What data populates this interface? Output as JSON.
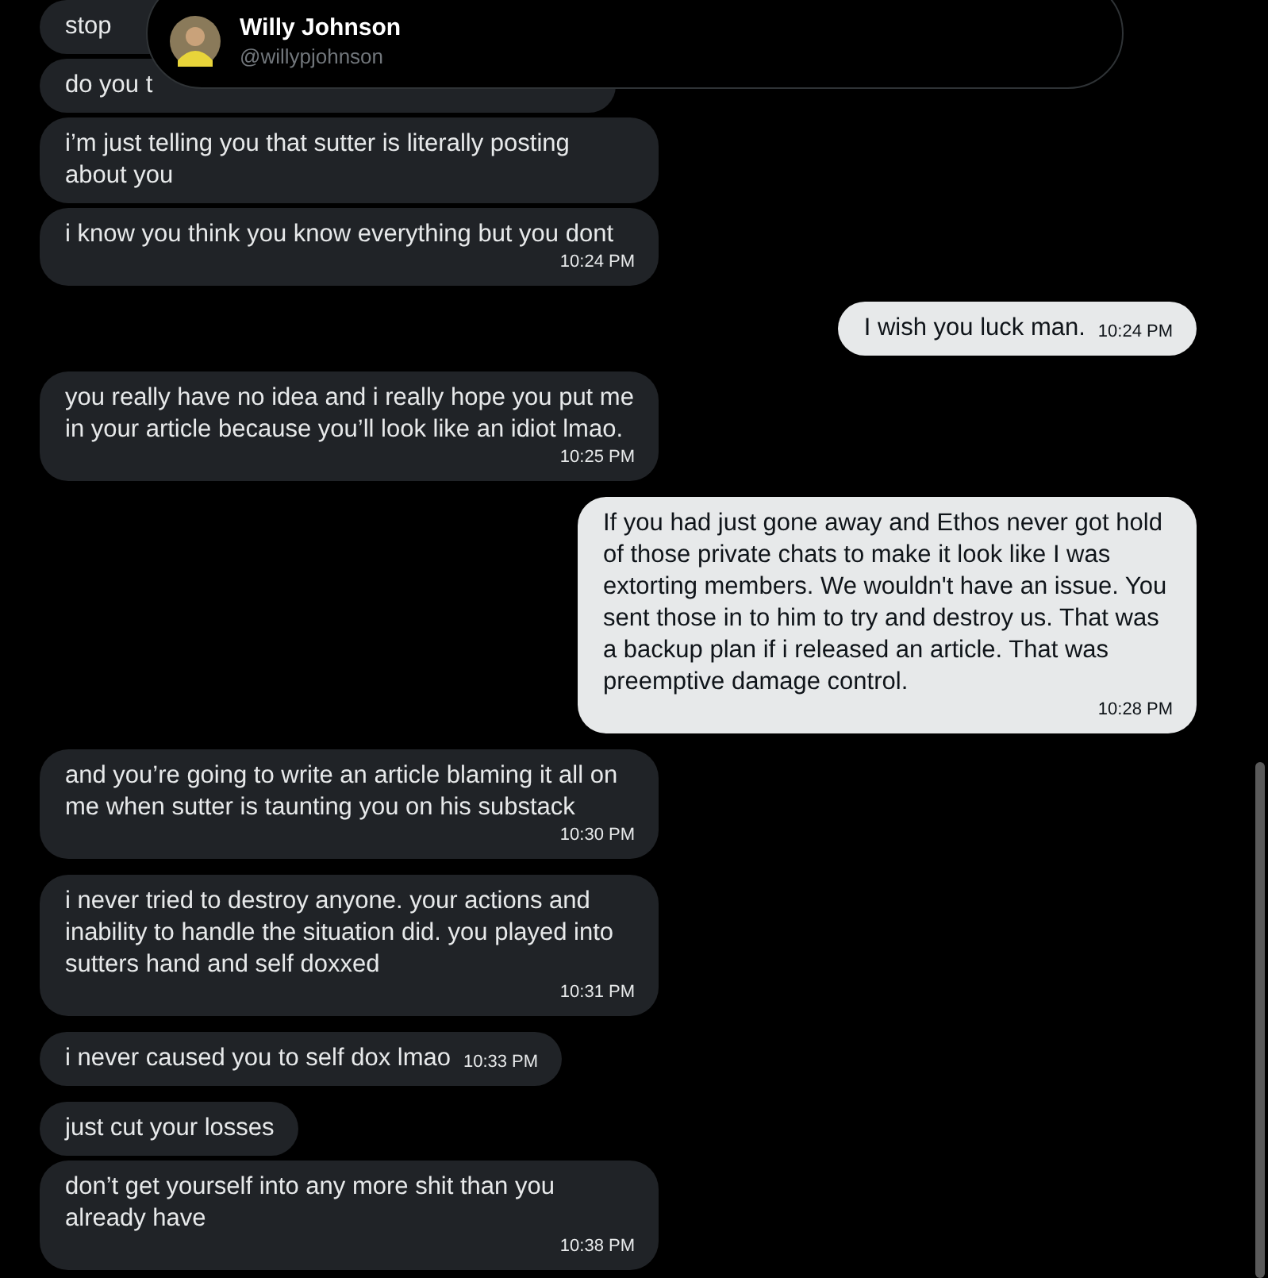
{
  "header": {
    "name": "Willy Johnson",
    "handle": "@willypjohnson"
  },
  "messages": [
    {
      "outgoing": false,
      "kind": "covered",
      "text": "stop"
    },
    {
      "outgoing": false,
      "kind": "covered",
      "text": "do you t"
    },
    {
      "outgoing": false,
      "kind": "normal",
      "text": "i’m just telling you that sutter is literally posting about you"
    },
    {
      "outgoing": false,
      "kind": "normal",
      "text": "i know you think you know everything but you dont",
      "time": "10:24 PM"
    },
    {
      "outgoing": true,
      "kind": "normal",
      "text": "I wish you luck man.",
      "time": "10:24 PM"
    },
    {
      "outgoing": false,
      "kind": "normal",
      "text": "you really have no idea and i really hope you put me in your article because you’ll look like an idiot lmao.",
      "time": "10:25 PM"
    },
    {
      "outgoing": true,
      "kind": "normal",
      "text": "If you had just gone away and Ethos never got hold of those private chats to make it look like I was extorting members. We wouldn't have an issue. You sent those in to him to try and destroy us. That was a backup plan if i released an article. That was preemptive damage control.",
      "time": "10:28 PM"
    },
    {
      "outgoing": false,
      "kind": "normal",
      "text": "and you’re going to write an article blaming it all on me when sutter is taunting you on his substack",
      "time": "10:30 PM"
    },
    {
      "outgoing": false,
      "kind": "normal",
      "text": "i never tried to destroy anyone. your actions and inability to handle the situation did. you played into sutters hand and self doxxed",
      "time": "10:31 PM"
    },
    {
      "outgoing": false,
      "kind": "normal",
      "text": "i never caused you to self dox lmao",
      "time": "10:33 PM"
    },
    {
      "outgoing": false,
      "kind": "normal",
      "text": "just cut your losses"
    },
    {
      "outgoing": false,
      "kind": "normal",
      "text": "don’t get yourself into any more shit than you already have",
      "time": "10:38 PM"
    }
  ]
}
